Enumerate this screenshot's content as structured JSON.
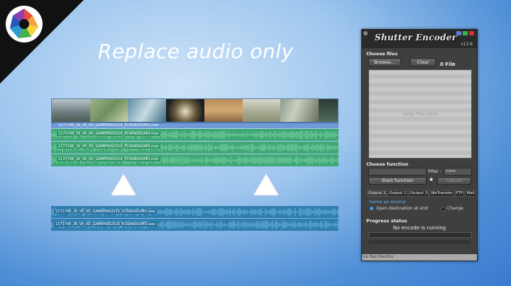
{
  "headline": "Replace audio only",
  "colors": {
    "accent_green": "#3fa876",
    "accent_blue": "#2f7eae",
    "window_bg": "#3f3f3f"
  },
  "top_timeline": {
    "video_clip_label": "1171748_26_VR_KO_GAMEFAIR2016_ECRANSOUMO.mov",
    "audio_tracks": [
      "1171748_26_VR_KO_GAMEFAIR2016_ECRANSOUMO.mov",
      "1171748_26_VR_KO_GAMEFAIR2016_ECRANSOUMO.mov",
      "1171748_26_VR_KO_GAMEFAIR2016_ECRANSOUMO.mov"
    ]
  },
  "bottom_timeline": {
    "audio_tracks": [
      "1171748_26_VR_KO_GAMEFAIR2016_ECRANSOUMO.wav",
      "1171748_26_VR_KO_GAMEFAIR2016_ECRANSOUMO.wav"
    ]
  },
  "window": {
    "title": "Shutter Encoder",
    "version": "v13.8",
    "choose_files": "Choose files",
    "browse": "Browse...",
    "clear": "Clear",
    "file_count": "0 File",
    "drop_hint": "Drop files here",
    "choose_function": "Choose function",
    "filter_label": "Filter :",
    "filter_value": "none",
    "start_function": "Start function",
    "cancel": "Cancel",
    "tabs": [
      "Output 1",
      "Output 2",
      "Output 3",
      "WeTransfer",
      "FTP",
      "Mail"
    ],
    "same_as_source": "Same as source",
    "open_destination": "Open destination at end",
    "change": "Change",
    "progress_status": "Progress status",
    "no_encode": "No encode is running",
    "footer": "by Paul Pacifico"
  }
}
